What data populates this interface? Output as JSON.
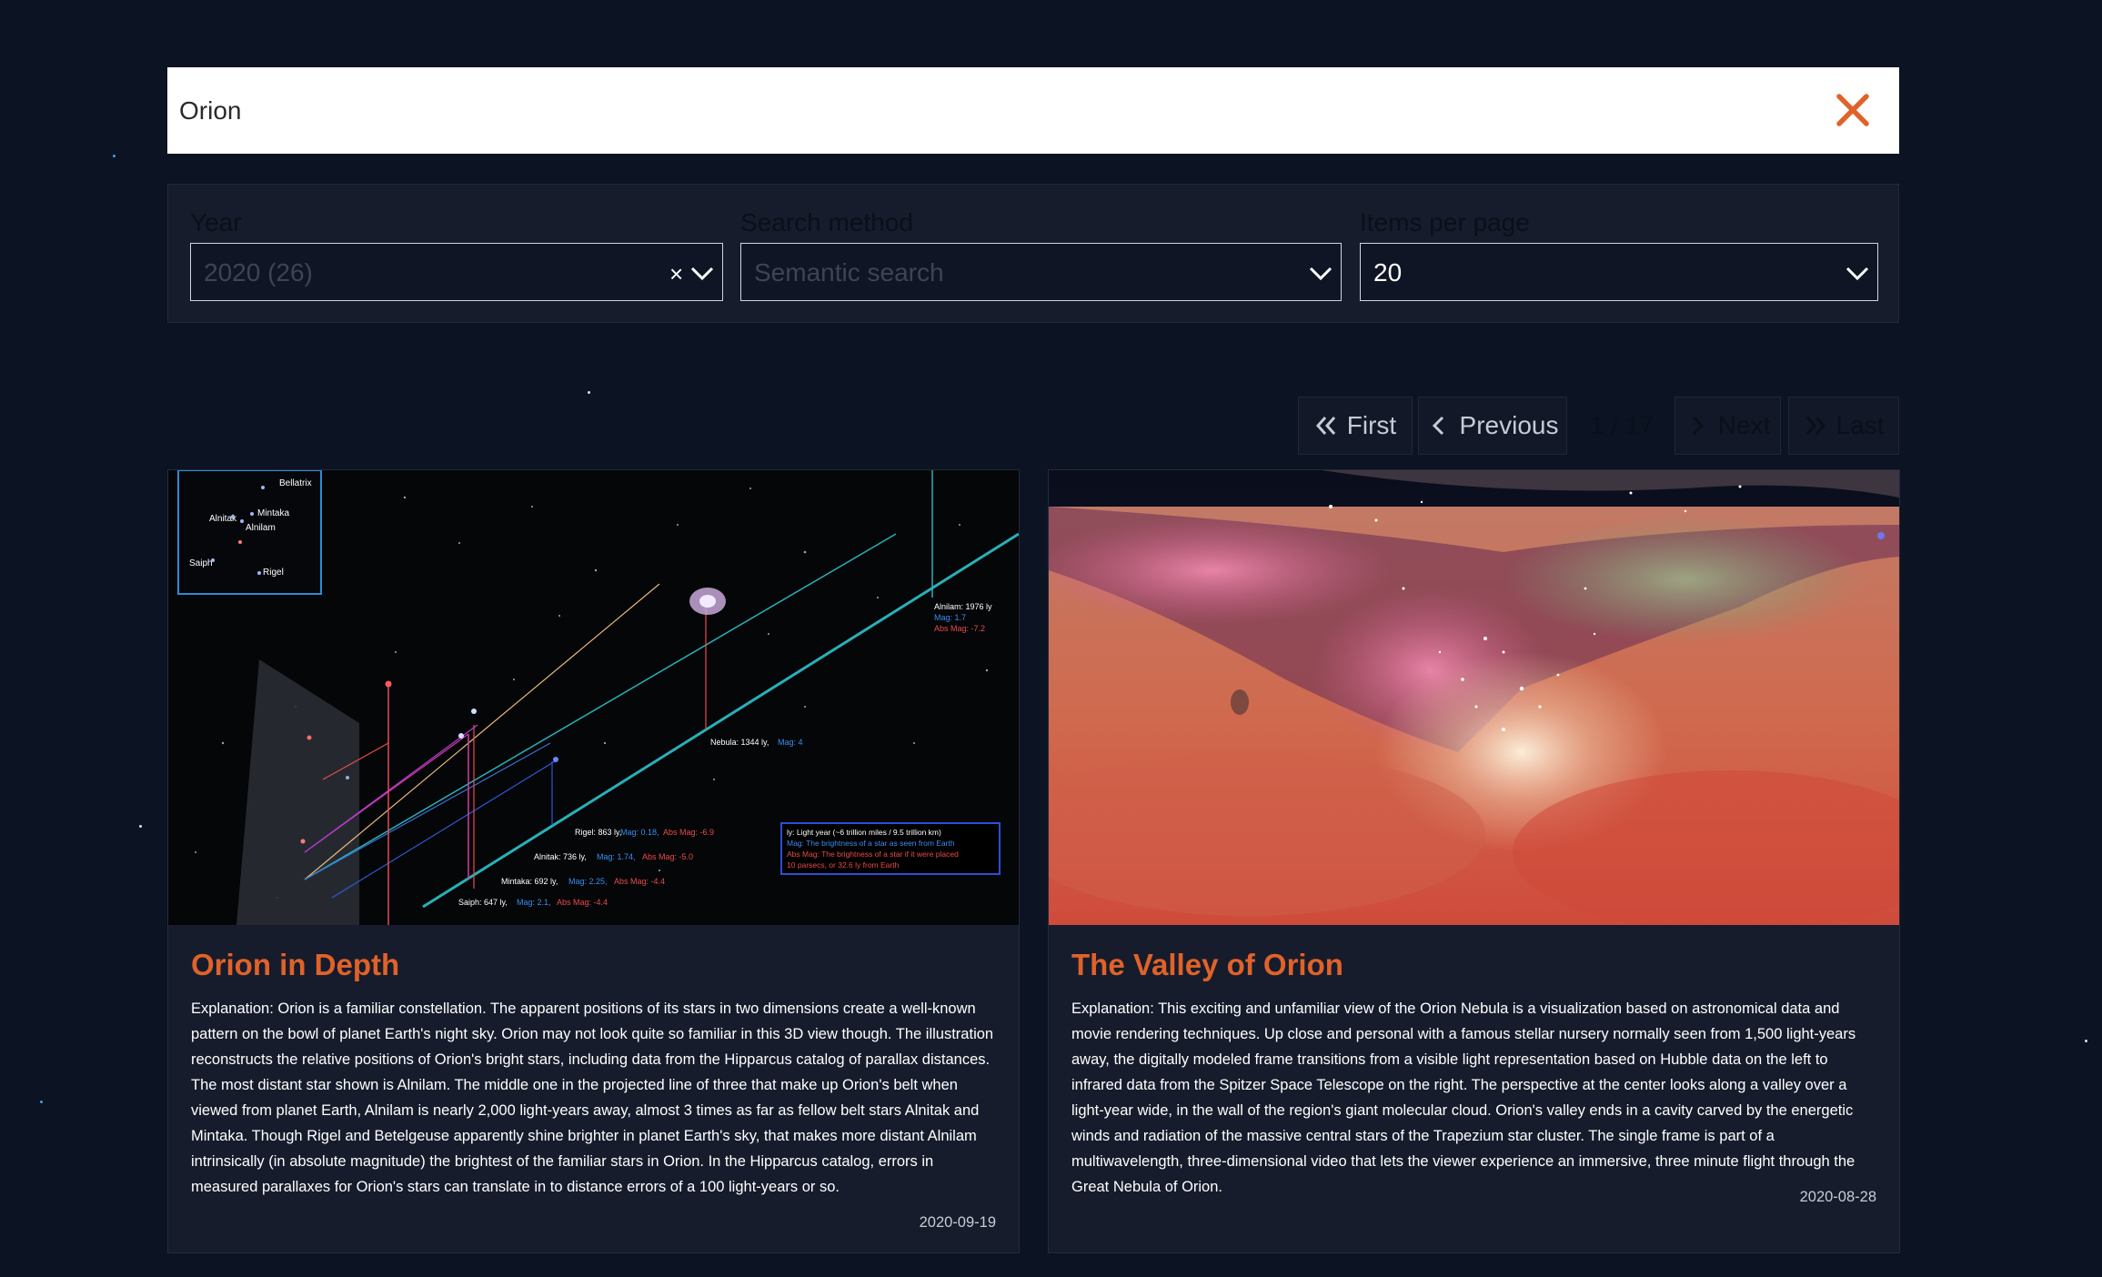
{
  "search": {
    "value": "Orion",
    "clear_icon": "close-x-icon",
    "accent_color": "#e0622a"
  },
  "filters": {
    "year": {
      "label": "Year",
      "value": "2020 (26)"
    },
    "search_method": {
      "label": "Search method",
      "value": "Semantic search"
    },
    "items_per_page": {
      "label": "Items per page",
      "value": "20"
    }
  },
  "pagination": {
    "first": "First",
    "previous": "Previous",
    "indicator": "1 / 17",
    "next": "Next",
    "last": "Last"
  },
  "cards": [
    {
      "title": "Orion in Depth",
      "explanation": "Explanation: Orion is a familiar constellation. The apparent positions of its stars in two dimensions create a well-known pattern on the bowl of planet Earth's night sky. Orion may not look quite so familiar in this 3D view though. The illustration reconstructs the relative positions of Orion's bright stars, including data from the Hipparcus catalog of parallax distances. The most distant star shown is Alnilam. The middle one in the projected line of three that make up Orion's belt when viewed from planet Earth, Alnilam is nearly 2,000 light-years away, almost 3 times as far as fellow belt stars Alnitak and Mintaka. Though Rigel and Betelgeuse apparently shine brighter in planet Earth's sky, that makes more distant Alnilam intrinsically (in absolute magnitude) the brightest of the familiar stars in Orion. In the Hipparcus catalog, errors in measured parallaxes for Orion's stars can translate in to distance errors of a 100 light-years or so.",
      "date": "2020-09-19",
      "image": {
        "inset_labels": {
          "bellatrix": "Bellatrix",
          "alnitak": "Alnitak",
          "mintaka": "Mintaka",
          "alnilam": "Alnilam",
          "saiph": "Saiph",
          "rigel": "Rigel"
        },
        "annotations": {
          "alnilam": "Alnilam: 1976 ly",
          "alnilam_mag": "Mag: 1.7",
          "alnilam_abs": "Abs Mag: -7.2",
          "nebula": "Nebula: 1344 ly,",
          "nebula_mag": "Mag: 4",
          "rigel": "Rigel: 863 ly,",
          "rigel_mag": "Mag: 0.18,",
          "rigel_abs": "Abs Mag: -6.9",
          "alnitak": "Alnitak: 736 ly,",
          "alnitak_mag": "Mag: 1.74,",
          "alnitak_abs": "Abs Mag: -5.0",
          "mintaka": "Mintaka: 692 ly,",
          "mintaka_mag": "Mag: 2.25,",
          "mintaka_abs": "Abs Mag: -4.4",
          "saiph": "Saiph: 647 ly,",
          "saiph_mag": "Mag: 2.1,",
          "saiph_abs": "Abs Mag: -4.4"
        },
        "legend": {
          "ly": "ly: Light year (~6 trillion miles / 9.5 trillion km)",
          "mag": "Mag: The brightness of a star as seen from Earth",
          "abs1": "Abs Mag: The brightness of a star if it were placed",
          "abs2": "10 parsecs, or 32.6 ly from Earth"
        }
      }
    },
    {
      "title": "The Valley of Orion",
      "explanation": "Explanation: This exciting and unfamiliar view of the Orion Nebula is a visualization based on astronomical data and movie rendering techniques. Up close and personal with a famous stellar nursery normally seen from 1,500 light-years away, the digitally modeled frame transitions from a visible light representation based on Hubble data on the left to infrared data from the Spitzer Space Telescope on the right. The perspective at the center looks along a valley over a light-year wide, in the wall of the region's giant molecular cloud. Orion's valley ends in a cavity carved by the energetic winds and radiation of the massive central stars of the Trapezium star cluster. The single frame is part of a multiwavelength, three-dimensional video that lets the viewer experience an immersive, three minute flight through the Great Nebula of Orion.",
      "date": "2020-08-28"
    }
  ]
}
